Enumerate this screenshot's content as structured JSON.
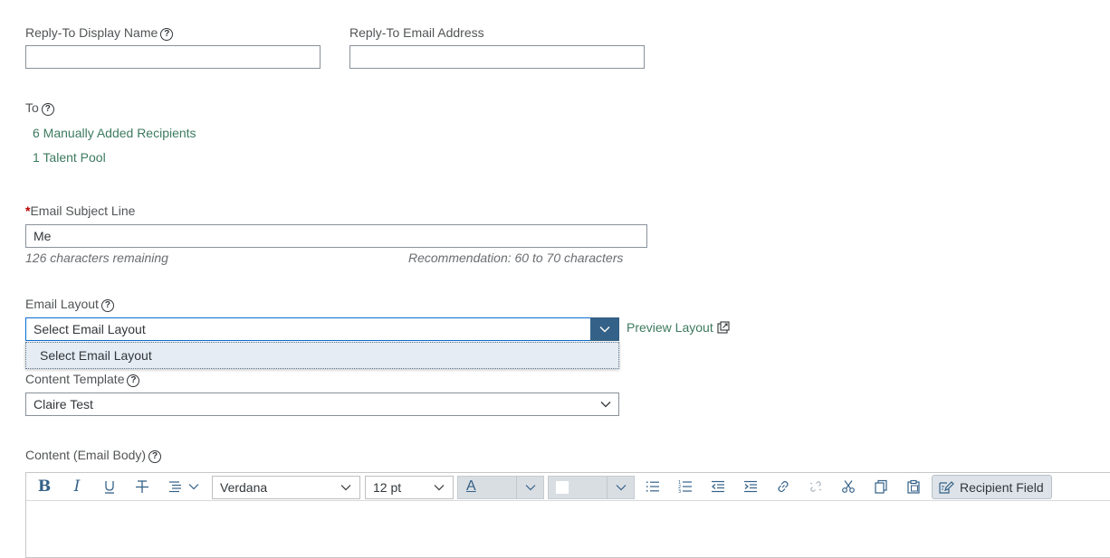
{
  "reply_to": {
    "display_name_label": "Reply-To Display Name",
    "display_name_value": "",
    "email_label": "Reply-To Email Address",
    "email_value": ""
  },
  "to": {
    "label": "To",
    "recipients_link": "6 Manually Added Recipients",
    "talent_pool_link": "1 Talent Pool"
  },
  "subject": {
    "required_mark": "*",
    "label": "Email Subject Line",
    "value": "Me",
    "remaining": "126 characters remaining",
    "recommendation": "Recommendation: 60 to 70 characters"
  },
  "layout": {
    "label": "Email Layout",
    "selected": "Select Email Layout",
    "preview_link": "Preview Layout",
    "options": [
      "Select Email Layout"
    ]
  },
  "template": {
    "label": "Content Template",
    "selected": "Claire Test"
  },
  "content": {
    "label": "Content (Email Body)",
    "font": "Verdana",
    "size": "12 pt",
    "text_color_glyph": "A",
    "recipient_field_label": "Recipient Field"
  },
  "colors": {
    "link": "#3c7a5f",
    "focus_button": "#346187",
    "dropdown_bg": "#e5ecf3",
    "required": "#bb0000"
  }
}
